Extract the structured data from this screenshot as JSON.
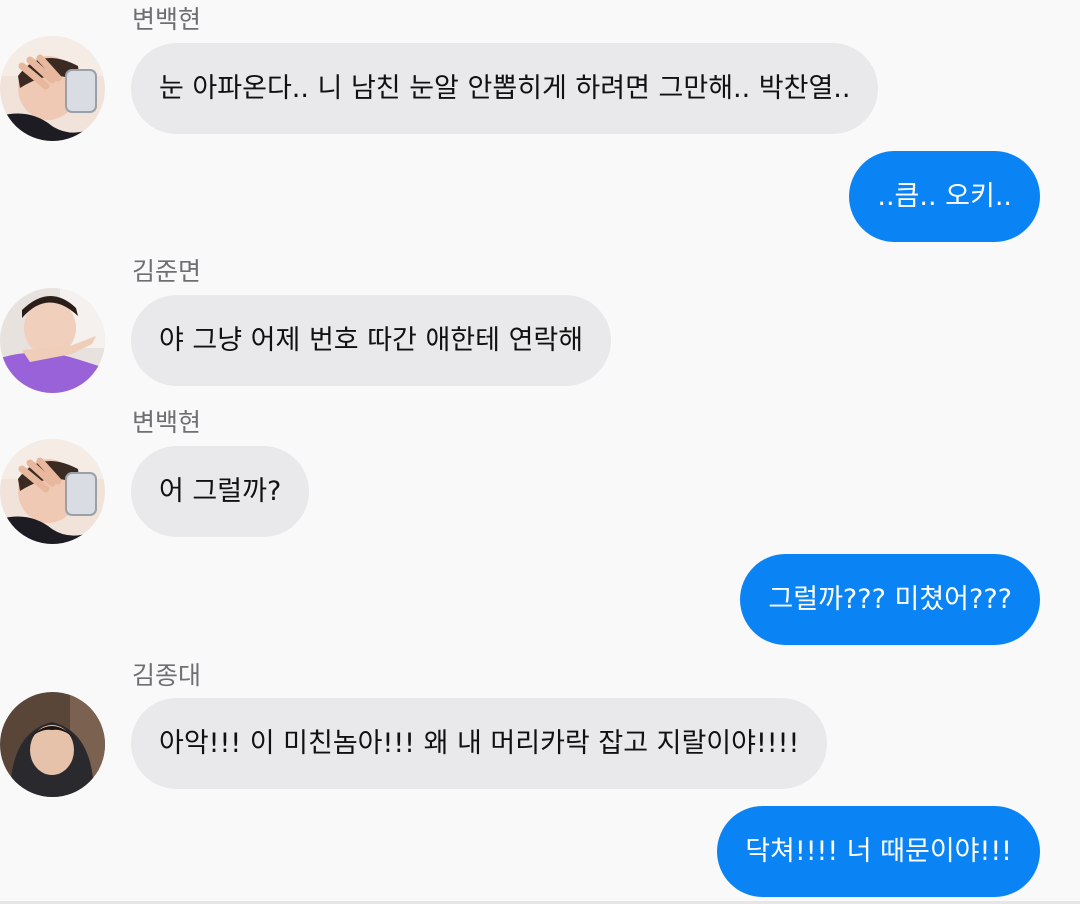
{
  "conversation": {
    "messages": [
      {
        "type": "incoming",
        "sender": "변백현",
        "avatar": "avatar-baekhyun",
        "text": "눈 아파온다.. 니 남친 눈알 안뽑히게 하려면 그만해.. 박찬열.."
      },
      {
        "type": "outgoing",
        "text": "..큼.. 오키.."
      },
      {
        "type": "incoming",
        "sender": "김준면",
        "avatar": "avatar-junmyeon",
        "text": "야 그냥 어제 번호 따간 애한테 연락해"
      },
      {
        "type": "incoming",
        "sender": "변백현",
        "avatar": "avatar-baekhyun",
        "text": "어 그럴까?"
      },
      {
        "type": "outgoing",
        "text": "그럴까??? 미쳤어???"
      },
      {
        "type": "incoming",
        "sender": "김종대",
        "avatar": "avatar-jongdae",
        "text": "아악!!! 이 미친놈아!!! 왜 내 머리카락 잡고 지랄이야!!!!"
      },
      {
        "type": "outgoing",
        "text": "닥쳐!!!! 너 때문이야!!!"
      }
    ]
  },
  "colors": {
    "background": "#f9f9fa",
    "incoming_bubble": "#e9e9eb",
    "outgoing_bubble": "#0a84f5",
    "sender_name": "#6f6f73"
  }
}
